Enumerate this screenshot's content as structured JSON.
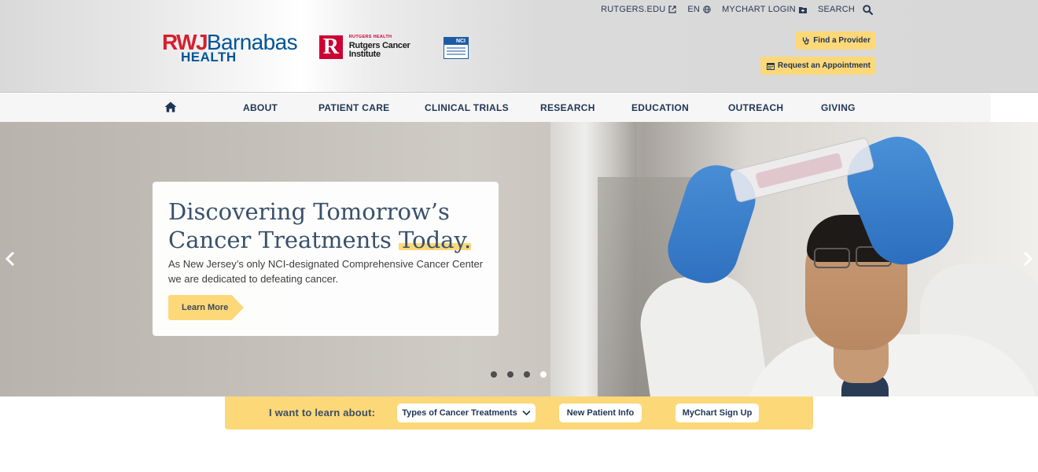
{
  "header": {
    "utility": {
      "rutgers": "RUTGERS.EDU",
      "language": "EN",
      "mychart": "MYCHART LOGIN",
      "search": "SEARCH"
    },
    "logos": {
      "rwj_part1": "RWJ",
      "rwj_part2": "Barnabas",
      "rwj_part3": "HEALTH",
      "rci_mark": "R",
      "rci_small": "RUTGERS HEALTH",
      "rci_name": "Rutgers Cancer Institute",
      "nci_label": "NCI"
    },
    "cta": {
      "provider": "Find a Provider",
      "appointment": "Request an Appointment"
    }
  },
  "nav": {
    "items": [
      "ABOUT",
      "PATIENT CARE",
      "CLINICAL TRIALS",
      "RESEARCH",
      "EDUCATION",
      "OUTREACH",
      "GIVING"
    ]
  },
  "hero": {
    "title_line1": "Discovering Tomorrow’s",
    "title_line2_pre": "Cancer Treatments ",
    "title_line2_highlight": "Today.",
    "subtitle": "As New Jersey’s only NCI-designated Comprehensive Cancer Center we are dedicated to defeating cancer.",
    "button": "Learn More",
    "slides": 4,
    "active_slide": 4
  },
  "learn_bar": {
    "label": "I want to learn about:",
    "options": [
      "Types of Cancer Treatments",
      "New Patient Info",
      "MyChart Sign Up"
    ]
  },
  "colors": {
    "accent_yellow": "#fcd878",
    "navy": "#1f3555",
    "rwj_red": "#d51f2f",
    "rwj_blue": "#005596",
    "rutgers_red": "#cc0033"
  }
}
